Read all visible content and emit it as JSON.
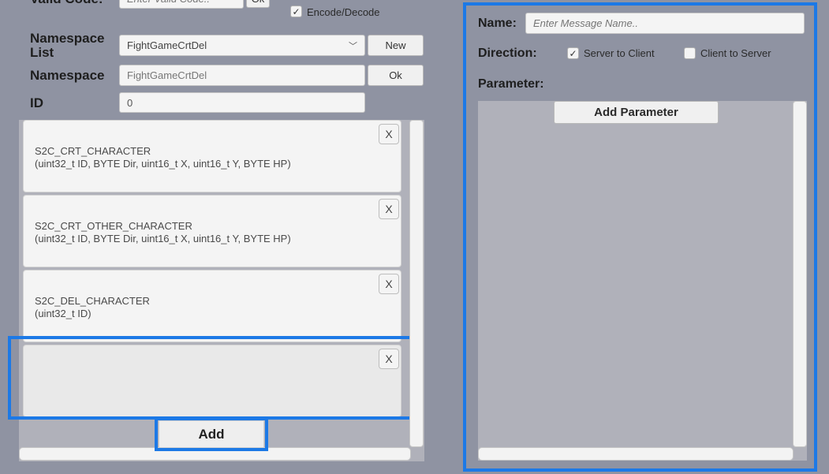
{
  "left": {
    "valid_code": {
      "label": "Valid Code:",
      "placeholder": "Enter Valid Code..",
      "ok_label": "Ok"
    },
    "encode_decode": {
      "label": "Encode/Decode",
      "checked": true
    },
    "namespace_list": {
      "label_line1": "Namespace",
      "label_line2": "List",
      "selected": "FightGameCrtDel",
      "new_label": "New"
    },
    "namespace": {
      "label": "Namespace",
      "value": "FightGameCrtDel",
      "ok_label": "Ok"
    },
    "id": {
      "label": "ID",
      "value": "0"
    },
    "messages": [
      {
        "name": "S2C_CRT_CHARACTER",
        "params": "(uint32_t ID, BYTE Dir, uint16_t X, uint16_t Y, BYTE HP)",
        "remove_label": "X"
      },
      {
        "name": "S2C_CRT_OTHER_CHARACTER",
        "params": "(uint32_t ID, BYTE Dir, uint16_t X, uint16_t Y, BYTE HP)",
        "remove_label": "X"
      },
      {
        "name": "S2C_DEL_CHARACTER",
        "params": "(uint32_t ID)",
        "remove_label": "X"
      },
      {
        "name": "",
        "params": "",
        "remove_label": "X"
      }
    ],
    "add_label": "Add"
  },
  "right": {
    "name": {
      "label": "Name:",
      "placeholder": "Enter Message Name.."
    },
    "direction": {
      "label": "Direction:",
      "server_to_client": {
        "label": "Server to Client",
        "checked": true
      },
      "client_to_server": {
        "label": "Client to Server",
        "checked": false
      }
    },
    "parameter": {
      "label": "Parameter:",
      "add_label": "Add Parameter"
    }
  },
  "colors": {
    "highlight": "#1c79e6",
    "background": "#8f93a2",
    "panel": "#b0b1ba"
  }
}
